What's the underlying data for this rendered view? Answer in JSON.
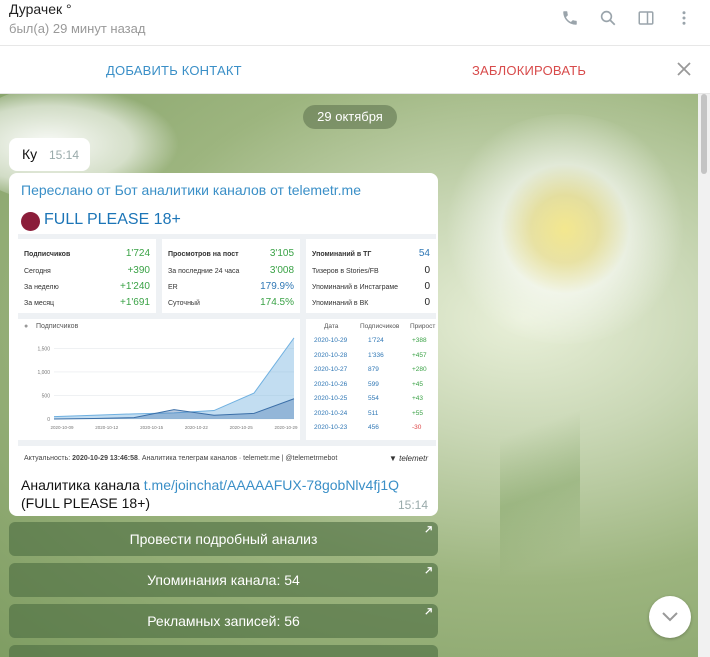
{
  "header": {
    "contact_name": "Дурачек °",
    "status": "был(а) 29 минут назад",
    "icons": [
      "phone-icon",
      "search-icon",
      "sidebar-toggle-icon",
      "more-vertical-icon"
    ]
  },
  "action_bar": {
    "add_contact": "ДОБАВИТЬ КОНТАКТ",
    "block": "ЗАБЛОКИРОВАТЬ"
  },
  "chat": {
    "date": "29 октября",
    "messages": [
      {
        "text": "Ку",
        "time": "15:14"
      }
    ],
    "forwarded": {
      "from": "Переслано от Бот аналитики каналов от telemetr.me",
      "card": {
        "channel_name": "FULL PLEASE 18+",
        "subs": {
          "head_label": "Подписчиков",
          "head_value": "1'724",
          "rows": [
            {
              "label": "Сегодня",
              "value": "+390"
            },
            {
              "label": "За неделю",
              "value": "+1'240"
            },
            {
              "label": "За месяц",
              "value": "+1'691"
            }
          ]
        },
        "views": {
          "head_label": "Просмотров на пост",
          "head_value": "3'105",
          "rows": [
            {
              "label": "За последние 24 часа",
              "value": "3'008"
            },
            {
              "label": "ER",
              "value": "179.9%"
            },
            {
              "label": "Суточный",
              "value": "174.5%"
            }
          ]
        },
        "mentions": {
          "head_label": "Упоминаний в ТГ",
          "head_value": "54",
          "rows": [
            {
              "label": "Тизеров в Stories/FB",
              "value": "0"
            },
            {
              "label": "Упоминаний в Инстаграме",
              "value": "0"
            },
            {
              "label": "Упоминаний в ВК",
              "value": "0"
            }
          ]
        },
        "graph_label": "Подписчиков",
        "table": {
          "headers": [
            "Дата",
            "Подписчиков",
            "Прирост"
          ],
          "rows": [
            {
              "date": "2020-10-29",
              "subs": "1'724",
              "growth": "+388"
            },
            {
              "date": "2020-10-28",
              "subs": "1'336",
              "growth": "+457"
            },
            {
              "date": "2020-10-27",
              "subs": "879",
              "growth": "+280"
            },
            {
              "date": "2020-10-26",
              "subs": "599",
              "growth": "+45"
            },
            {
              "date": "2020-10-25",
              "subs": "554",
              "growth": "+43"
            },
            {
              "date": "2020-10-24",
              "subs": "511",
              "growth": "+55"
            },
            {
              "date": "2020-10-23",
              "subs": "456",
              "growth": "-30"
            }
          ]
        },
        "footer_prefix": "Актуальность:",
        "footer_time": "2020-10-29 13:46:58",
        "footer_rest": ". Аналитика телеграм каналов · telemetr.me | @telemetrmebot",
        "brand": "telemetr"
      },
      "text_prefix": "Аналитика канала ",
      "link": "t.me/joinchat/AAAAAFUX-78gobNlv4fj1Q",
      "text_suffix": " (FULL PLEASE 18+)",
      "time": "15:14"
    },
    "keyboard": [
      "Провести подробный анализ",
      "Упоминания канала: 54",
      "Рекламных записей: 56"
    ]
  },
  "chart_data": {
    "type": "area",
    "title": "Подписчиков",
    "x": [
      "2020-10-09",
      "2020-10-12",
      "2020-10-15",
      "2020-10-22",
      "2020-10-25",
      "2020-10-29"
    ],
    "xlabel": "",
    "ylabel": "",
    "ylim": [
      0,
      1700
    ],
    "yticks": [
      0,
      500,
      1000,
      1500
    ],
    "grid": true,
    "series": [
      {
        "values": [
          50,
          80,
          110,
          130,
          180,
          550,
          1724
        ]
      },
      {
        "values": [
          0,
          10,
          30,
          200,
          80,
          120,
          430
        ]
      }
    ]
  }
}
